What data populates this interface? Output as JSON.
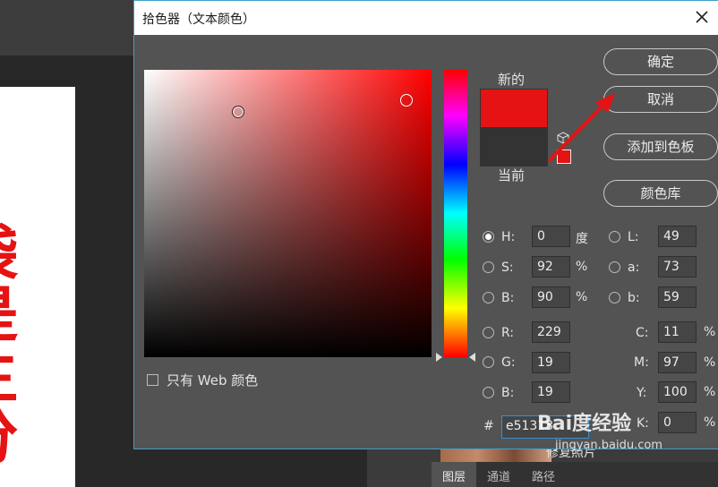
{
  "background": {
    "doc_text": "袋是主分",
    "layer_name": "修复照片",
    "panel_tabs": [
      "图层",
      "通道",
      "路径"
    ]
  },
  "dialog": {
    "title": "拾色器（文本颜色）",
    "label_new": "新的",
    "label_current": "当前",
    "new_color": "#e51313",
    "current_color": "#333333",
    "buttons": {
      "ok": "确定",
      "cancel": "取消",
      "add_to_swatches": "添加到色板",
      "color_libraries": "颜色库"
    },
    "only_web_colors": "只有 Web 颜色",
    "fields": {
      "H": {
        "label": "H:",
        "value": "0",
        "unit": "度"
      },
      "S": {
        "label": "S:",
        "value": "92",
        "unit": "%"
      },
      "Bv": {
        "label": "B:",
        "value": "90",
        "unit": "%"
      },
      "R": {
        "label": "R:",
        "value": "229"
      },
      "G": {
        "label": "G:",
        "value": "19"
      },
      "Bc": {
        "label": "B:",
        "value": "19"
      },
      "L": {
        "label": "L:",
        "value": "49"
      },
      "a": {
        "label": "a:",
        "value": "73"
      },
      "b": {
        "label": "b:",
        "value": "59"
      },
      "C": {
        "label": "C:",
        "value": "11",
        "unit": "%"
      },
      "M": {
        "label": "M:",
        "value": "97",
        "unit": "%"
      },
      "Y": {
        "label": "Y:",
        "value": "100",
        "unit": "%"
      },
      "K": {
        "label": "K:",
        "value": "0",
        "unit": "%"
      }
    },
    "hex_label": "#",
    "hex_value": "e51313"
  },
  "watermark": {
    "text": "Bai度经验",
    "url": "jingyan.baidu.com"
  }
}
